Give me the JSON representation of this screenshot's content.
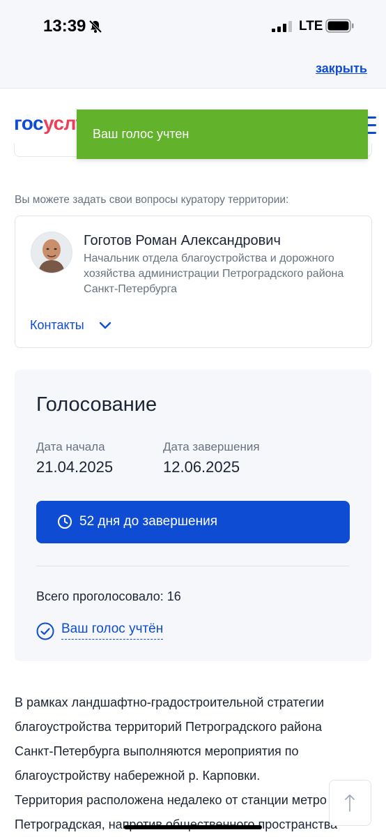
{
  "status_bar": {
    "time": "13:39",
    "network": "LTE"
  },
  "browser": {
    "close_label": "закрыть"
  },
  "header": {
    "logo_blue": "гос",
    "logo_red": "ус",
    "logo_rest": "луги"
  },
  "toast": {
    "message": "Ваш голос учтен"
  },
  "curator": {
    "intro": "Вы можете задать свои вопросы куратору территории:",
    "name": "Гоготов Роман Александрович",
    "role": "Начальник отдела благоустройства и дорожного хозяйства администрации Петроградского района Санкт-Петербурга",
    "contacts_label": "Контакты"
  },
  "voting": {
    "title": "Голосование",
    "start_label": "Дата начала",
    "start_date": "21.04.2025",
    "end_label": "Дата завершения",
    "end_date": "12.06.2025",
    "timer_label": "52 дня до завершения",
    "total_votes": "Всего проголосовало: 16",
    "vote_status": "Ваш голос учтён"
  },
  "description": {
    "lines": [
      "В рамках ландшафтно-градостроительной стратегии",
      "благоустройства территорий Петроградского района",
      "Санкт-Петербурга выполняются мероприятия по",
      "благоустройству набережной р. Карповки.",
      "Территория расположена недалеко от станции метро",
      "Петроградская, напротив общественного пространства"
    ]
  },
  "colors": {
    "primary": "#0d4cd3",
    "toast": "#63b22b",
    "logo_red": "#ee3f58"
  }
}
